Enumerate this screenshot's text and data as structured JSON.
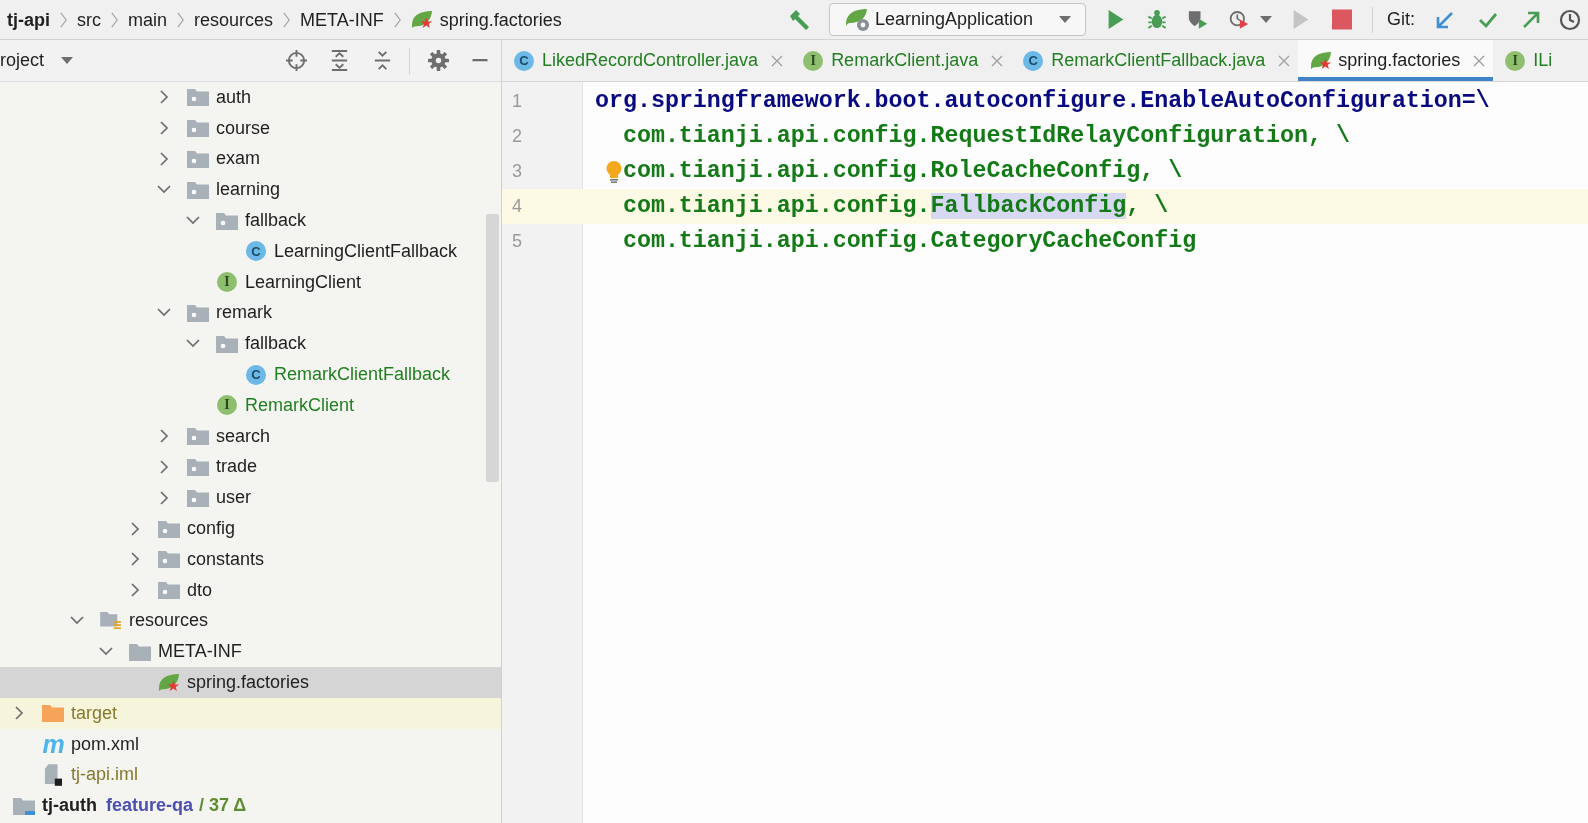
{
  "breadcrumb": [
    {
      "label": "tj-api",
      "kind": "module"
    },
    {
      "label": "src",
      "kind": "folder"
    },
    {
      "label": "main",
      "kind": "folder"
    },
    {
      "label": "resources",
      "kind": "folder"
    },
    {
      "label": "META-INF",
      "kind": "folder"
    },
    {
      "label": "spring.factories",
      "kind": "spring-file"
    }
  ],
  "toolbar": {
    "run_configuration": "LearningApplication",
    "actions": [
      {
        "kind": "run",
        "disabled": false
      },
      {
        "kind": "debug",
        "disabled": false
      },
      {
        "kind": "coverage",
        "disabled": false
      },
      {
        "kind": "profile",
        "disabled": false
      },
      {
        "kind": "run",
        "disabled": true
      },
      {
        "kind": "stop",
        "disabled": false
      }
    ],
    "git_label": "Git:",
    "git_actions": [
      {
        "kind": "update"
      },
      {
        "kind": "commit"
      },
      {
        "kind": "push"
      },
      {
        "kind": "history"
      }
    ]
  },
  "project_panel": {
    "title": "roject"
  },
  "tree": [
    {
      "children": [
        {
          "children": [
            {
              "children": [
                {
                  "children": [
                    {
                      "children": [
                        {
                          "children": [
                            {
                              "label": "auth",
                              "kind": "package",
                              "color": "#1f1f1f",
                              "selected": false,
                              "expanded": false
                            },
                            {
                              "label": "course",
                              "kind": "package",
                              "color": "#1f1f1f",
                              "selected": false,
                              "expanded": false
                            },
                            {
                              "label": "exam",
                              "kind": "package",
                              "color": "#1f1f1f",
                              "selected": false,
                              "expanded": false
                            },
                            {
                              "label": "learning",
                              "kind": "package",
                              "color": "#1f1f1f",
                              "selected": false,
                              "expanded": true,
                              "children": [
                                {
                                  "label": "fallback",
                                  "kind": "package",
                                  "color": "#1f1f1f",
                                  "selected": false,
                                  "expanded": true,
                                  "children": [
                                    {
                                      "label": "LearningClientFallback",
                                      "kind": "class",
                                      "badge": "C",
                                      "color": "#1f1f1f",
                                      "selected": false
                                    }
                                  ]
                                },
                                {
                                  "label": "LearningClient",
                                  "kind": "interface",
                                  "badge": "I",
                                  "color": "#1f1f1f",
                                  "selected": false
                                }
                              ]
                            },
                            {
                              "label": "remark",
                              "kind": "package",
                              "color": "#1f1f1f",
                              "selected": false,
                              "expanded": true,
                              "children": [
                                {
                                  "label": "fallback",
                                  "kind": "package",
                                  "color": "#1f1f1f",
                                  "selected": false,
                                  "expanded": true,
                                  "children": [
                                    {
                                      "label": "RemarkClientFallback",
                                      "kind": "class",
                                      "badge": "C",
                                      "color": "#217f21",
                                      "selected": false
                                    }
                                  ]
                                },
                                {
                                  "label": "RemarkClient",
                                  "kind": "interface",
                                  "badge": "I",
                                  "color": "#217f21",
                                  "selected": false
                                }
                              ]
                            },
                            {
                              "label": "search",
                              "kind": "package",
                              "color": "#1f1f1f",
                              "selected": false,
                              "expanded": false
                            },
                            {
                              "label": "trade",
                              "kind": "package",
                              "color": "#1f1f1f",
                              "selected": false,
                              "expanded": false
                            },
                            {
                              "label": "user",
                              "kind": "package",
                              "color": "#1f1f1f",
                              "selected": false,
                              "expanded": false
                            }
                          ]
                        },
                        {
                          "label": "config",
                          "kind": "package",
                          "color": "#1f1f1f",
                          "selected": false,
                          "expanded": false
                        },
                        {
                          "label": "constants",
                          "kind": "package",
                          "color": "#1f1f1f",
                          "selected": false,
                          "expanded": false
                        },
                        {
                          "label": "dto",
                          "kind": "package",
                          "color": "#1f1f1f",
                          "selected": false,
                          "expanded": false
                        }
                      ]
                    }
                  ]
                },
                {
                  "label": "resources",
                  "kind": "resources",
                  "color": "#1f1f1f",
                  "selected": false,
                  "expanded": true,
                  "children": [
                    {
                      "label": "META-INF",
                      "kind": "folder",
                      "color": "#1f1f1f",
                      "selected": false,
                      "expanded": true,
                      "children": [
                        {
                          "label": "spring.factories",
                          "kind": "spring-file",
                          "color": "#1f1f1f",
                          "selected": true
                        }
                      ]
                    }
                  ]
                }
              ]
            }
          ]
        },
        {
          "label": "target",
          "kind": "excluded-folder",
          "color": "#86792d",
          "selected": false,
          "expanded": false
        },
        {
          "label": "pom.xml",
          "kind": "maven-file",
          "badge": "m",
          "color": "#1f1f1f",
          "selected": false
        },
        {
          "label": "tj-api.iml",
          "kind": "module-file",
          "color": "#86792d",
          "selected": false
        }
      ]
    },
    {
      "label": "tj-auth",
      "kind": "module",
      "branch": "feature-qa",
      "changes": "/ 37 Δ",
      "color": "#1f1f1f",
      "selected": false
    }
  ],
  "editor": {
    "tabs": [
      {
        "label": "LikedRecordController.java",
        "kind": "class",
        "badge": "C",
        "color": "#217f21",
        "selected": false,
        "close_button": true
      },
      {
        "label": "RemarkClient.java",
        "kind": "interface",
        "badge": "I",
        "color": "#217f21",
        "selected": false,
        "close_button": true
      },
      {
        "label": "RemarkClientFallback.java",
        "kind": "class",
        "badge": "C",
        "color": "#217f21",
        "selected": false,
        "close_button": true
      },
      {
        "label": "spring.factories",
        "kind": "spring-file",
        "color": "#1f1f1f",
        "selected": true,
        "close_button": true
      },
      {
        "label": "ILi",
        "kind": "interface",
        "badge": "I",
        "color": "#217f21",
        "selected": false,
        "close_button": false
      }
    ],
    "lines": [
      {
        "number": "1",
        "kind": "key",
        "current": false,
        "bulb": false,
        "segments": [
          {
            "text": "org.springframework.boot.autoconfigure.EnableAutoConfiguration=\\",
            "selected": false
          }
        ]
      },
      {
        "number": "2",
        "kind": "value",
        "current": false,
        "bulb": false,
        "segments": [
          {
            "text": "com.tianji.api.config.RequestIdRelayConfiguration, \\",
            "selected": false
          }
        ]
      },
      {
        "number": "3",
        "kind": "value",
        "current": false,
        "bulb": true,
        "segments": [
          {
            "text": "com.tianji.api.config.RoleCacheConfig, \\",
            "selected": false
          }
        ]
      },
      {
        "number": "4",
        "kind": "value",
        "current": true,
        "bulb": false,
        "segments": [
          {
            "text": "com.tianji.api.config.",
            "selected": false
          },
          {
            "text": "FallbackConfig",
            "selected": true
          },
          {
            "text": ", \\",
            "selected": false
          }
        ]
      },
      {
        "number": "5",
        "kind": "value",
        "current": false,
        "bulb": false,
        "segments": [
          {
            "text": "com.tianji.api.config.CategoryCacheConfig",
            "selected": false
          }
        ]
      }
    ]
  }
}
